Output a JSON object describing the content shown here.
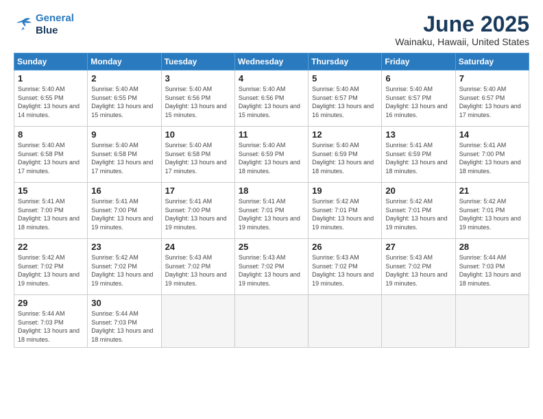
{
  "header": {
    "logo_line1": "General",
    "logo_line2": "Blue",
    "month": "June 2025",
    "location": "Wainaku, Hawaii, United States"
  },
  "weekdays": [
    "Sunday",
    "Monday",
    "Tuesday",
    "Wednesday",
    "Thursday",
    "Friday",
    "Saturday"
  ],
  "weeks": [
    [
      {
        "day": 1,
        "sunrise": "5:40 AM",
        "sunset": "6:55 PM",
        "daylight": "13 hours and 14 minutes."
      },
      {
        "day": 2,
        "sunrise": "5:40 AM",
        "sunset": "6:55 PM",
        "daylight": "13 hours and 15 minutes."
      },
      {
        "day": 3,
        "sunrise": "5:40 AM",
        "sunset": "6:56 PM",
        "daylight": "13 hours and 15 minutes."
      },
      {
        "day": 4,
        "sunrise": "5:40 AM",
        "sunset": "6:56 PM",
        "daylight": "13 hours and 15 minutes."
      },
      {
        "day": 5,
        "sunrise": "5:40 AM",
        "sunset": "6:57 PM",
        "daylight": "13 hours and 16 minutes."
      },
      {
        "day": 6,
        "sunrise": "5:40 AM",
        "sunset": "6:57 PM",
        "daylight": "13 hours and 16 minutes."
      },
      {
        "day": 7,
        "sunrise": "5:40 AM",
        "sunset": "6:57 PM",
        "daylight": "13 hours and 17 minutes."
      }
    ],
    [
      {
        "day": 8,
        "sunrise": "5:40 AM",
        "sunset": "6:58 PM",
        "daylight": "13 hours and 17 minutes."
      },
      {
        "day": 9,
        "sunrise": "5:40 AM",
        "sunset": "6:58 PM",
        "daylight": "13 hours and 17 minutes."
      },
      {
        "day": 10,
        "sunrise": "5:40 AM",
        "sunset": "6:58 PM",
        "daylight": "13 hours and 17 minutes."
      },
      {
        "day": 11,
        "sunrise": "5:40 AM",
        "sunset": "6:59 PM",
        "daylight": "13 hours and 18 minutes."
      },
      {
        "day": 12,
        "sunrise": "5:40 AM",
        "sunset": "6:59 PM",
        "daylight": "13 hours and 18 minutes."
      },
      {
        "day": 13,
        "sunrise": "5:41 AM",
        "sunset": "6:59 PM",
        "daylight": "13 hours and 18 minutes."
      },
      {
        "day": 14,
        "sunrise": "5:41 AM",
        "sunset": "7:00 PM",
        "daylight": "13 hours and 18 minutes."
      }
    ],
    [
      {
        "day": 15,
        "sunrise": "5:41 AM",
        "sunset": "7:00 PM",
        "daylight": "13 hours and 18 minutes."
      },
      {
        "day": 16,
        "sunrise": "5:41 AM",
        "sunset": "7:00 PM",
        "daylight": "13 hours and 19 minutes."
      },
      {
        "day": 17,
        "sunrise": "5:41 AM",
        "sunset": "7:00 PM",
        "daylight": "13 hours and 19 minutes."
      },
      {
        "day": 18,
        "sunrise": "5:41 AM",
        "sunset": "7:01 PM",
        "daylight": "13 hours and 19 minutes."
      },
      {
        "day": 19,
        "sunrise": "5:42 AM",
        "sunset": "7:01 PM",
        "daylight": "13 hours and 19 minutes."
      },
      {
        "day": 20,
        "sunrise": "5:42 AM",
        "sunset": "7:01 PM",
        "daylight": "13 hours and 19 minutes."
      },
      {
        "day": 21,
        "sunrise": "5:42 AM",
        "sunset": "7:01 PM",
        "daylight": "13 hours and 19 minutes."
      }
    ],
    [
      {
        "day": 22,
        "sunrise": "5:42 AM",
        "sunset": "7:02 PM",
        "daylight": "13 hours and 19 minutes."
      },
      {
        "day": 23,
        "sunrise": "5:42 AM",
        "sunset": "7:02 PM",
        "daylight": "13 hours and 19 minutes."
      },
      {
        "day": 24,
        "sunrise": "5:43 AM",
        "sunset": "7:02 PM",
        "daylight": "13 hours and 19 minutes."
      },
      {
        "day": 25,
        "sunrise": "5:43 AM",
        "sunset": "7:02 PM",
        "daylight": "13 hours and 19 minutes."
      },
      {
        "day": 26,
        "sunrise": "5:43 AM",
        "sunset": "7:02 PM",
        "daylight": "13 hours and 19 minutes."
      },
      {
        "day": 27,
        "sunrise": "5:43 AM",
        "sunset": "7:02 PM",
        "daylight": "13 hours and 19 minutes."
      },
      {
        "day": 28,
        "sunrise": "5:44 AM",
        "sunset": "7:03 PM",
        "daylight": "13 hours and 18 minutes."
      }
    ],
    [
      {
        "day": 29,
        "sunrise": "5:44 AM",
        "sunset": "7:03 PM",
        "daylight": "13 hours and 18 minutes."
      },
      {
        "day": 30,
        "sunrise": "5:44 AM",
        "sunset": "7:03 PM",
        "daylight": "13 hours and 18 minutes."
      },
      null,
      null,
      null,
      null,
      null
    ]
  ]
}
